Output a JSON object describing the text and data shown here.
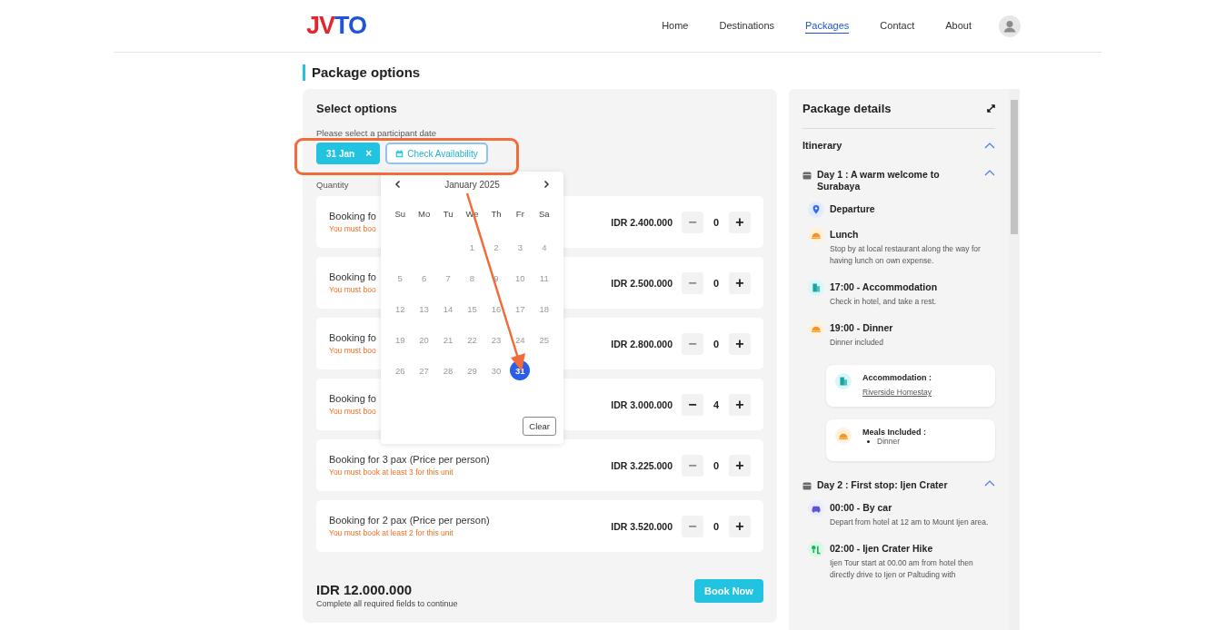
{
  "header": {
    "logo": [
      {
        "text": "JV",
        "color": "#e3262d"
      },
      {
        "text": "TO",
        "color": "#1f55d6"
      }
    ],
    "nav": [
      {
        "label": "Home",
        "selected": false
      },
      {
        "label": "Destinations",
        "selected": false
      },
      {
        "label": "Packages",
        "selected": true
      },
      {
        "label": "Contact",
        "selected": false
      },
      {
        "label": "About",
        "selected": false
      }
    ]
  },
  "page_title": "Package options",
  "options": {
    "title": "Select options",
    "date_label": "Please select a participant date",
    "date_chip": "31 Jan",
    "chip_remove": "×",
    "check_button": "Check Availability",
    "quantity_label": "Quantity",
    "calendar": {
      "open": true,
      "month": "January 2025",
      "weekdays": [
        "Su",
        "Mo",
        "Tu",
        "We",
        "Th",
        "Fr",
        "Sa"
      ],
      "weeks": [
        {
          "kind": "leading",
          "days": [
            {
              "label": "1",
              "disabled": true,
              "selected": false
            },
            {
              "label": "2",
              "disabled": true,
              "selected": false
            },
            {
              "label": "3",
              "disabled": true,
              "selected": false
            },
            {
              "label": "4",
              "disabled": true,
              "selected": false
            }
          ]
        },
        {
          "kind": "full",
          "days": [
            {
              "label": "5",
              "disabled": true,
              "selected": false
            },
            {
              "label": "6",
              "disabled": true,
              "selected": false
            },
            {
              "label": "7",
              "disabled": true,
              "selected": false
            },
            {
              "label": "8",
              "disabled": true,
              "selected": false
            },
            {
              "label": "9",
              "disabled": true,
              "selected": false
            },
            {
              "label": "10",
              "disabled": true,
              "selected": false
            },
            {
              "label": "11",
              "disabled": true,
              "selected": false
            }
          ]
        },
        {
          "kind": "full",
          "days": [
            {
              "label": "12",
              "disabled": true,
              "selected": false
            },
            {
              "label": "13",
              "disabled": true,
              "selected": false
            },
            {
              "label": "14",
              "disabled": true,
              "selected": false
            },
            {
              "label": "15",
              "disabled": true,
              "selected": false
            },
            {
              "label": "16",
              "disabled": true,
              "selected": false
            },
            {
              "label": "17",
              "disabled": true,
              "selected": false
            },
            {
              "label": "18",
              "disabled": true,
              "selected": false
            }
          ]
        },
        {
          "kind": "full",
          "days": [
            {
              "label": "19",
              "disabled": true,
              "selected": false
            },
            {
              "label": "20",
              "disabled": true,
              "selected": false
            },
            {
              "label": "21",
              "disabled": true,
              "selected": false
            },
            {
              "label": "22",
              "disabled": true,
              "selected": false
            },
            {
              "label": "23",
              "disabled": true,
              "selected": false
            },
            {
              "label": "24",
              "disabled": true,
              "selected": false
            },
            {
              "label": "25",
              "disabled": true,
              "selected": false
            }
          ]
        },
        {
          "kind": "trailing",
          "days": [
            {
              "label": "26",
              "disabled": true,
              "selected": false
            },
            {
              "label": "27",
              "disabled": true,
              "selected": false
            },
            {
              "label": "28",
              "disabled": true,
              "selected": false
            },
            {
              "label": "29",
              "disabled": true,
              "selected": false
            },
            {
              "label": "30",
              "disabled": true,
              "selected": false
            },
            {
              "label": "31",
              "disabled": false,
              "selected": true
            }
          ]
        }
      ],
      "clear_button": "Clear"
    },
    "bookings": [
      {
        "title": "Booking fo",
        "note": "You must boo",
        "price": "IDR 2.400.000",
        "quantity": "0",
        "minus": "−",
        "plus": "+",
        "minus_disabled": true
      },
      {
        "title": "Booking fo",
        "note": "You must boo",
        "price": "IDR 2.500.000",
        "quantity": "0",
        "minus": "−",
        "plus": "+",
        "minus_disabled": true
      },
      {
        "title": "Booking fo",
        "note": "You must boo",
        "price": "IDR 2.800.000",
        "quantity": "0",
        "minus": "−",
        "plus": "+",
        "minus_disabled": true
      },
      {
        "title": "Booking fo",
        "note": "You must boo",
        "price": "IDR 3.000.000",
        "quantity": "4",
        "minus": "−",
        "plus": "+",
        "minus_disabled": false
      },
      {
        "title": "Booking for 3 pax (Price per person)",
        "note": "You must book at least 3 for this unit",
        "price": "IDR 3.225.000",
        "quantity": "0",
        "minus": "−",
        "plus": "+",
        "minus_disabled": true
      },
      {
        "title": "Booking for 2 pax (Price per person)",
        "note": "You must book at least 2 for this unit",
        "price": "IDR 3.520.000",
        "quantity": "0",
        "minus": "−",
        "plus": "+",
        "minus_disabled": true
      }
    ],
    "total": "IDR 12.000.000",
    "total_note": "Complete all required fields to continue",
    "book_button": "Book Now"
  },
  "package_details": {
    "title": "Package details",
    "section": {
      "title": "Itinerary",
      "expanded": true,
      "days": [
        {
          "title": "Day 1 : A warm welcome to Surabaya",
          "expanded": true,
          "stops": [
            {
              "kind": "location",
              "title": "Departure"
            },
            {
              "kind": "meal",
              "title": "Lunch",
              "description": "Stop by at local restaurant along the way for having lunch on own expense."
            },
            {
              "kind": "hotel",
              "title": "17:00 - Accommodation",
              "description": "Check in hotel, and take a rest."
            },
            {
              "kind": "meal",
              "title": "19:00 - Dinner",
              "description": "Dinner included"
            }
          ],
          "info_cards": [
            {
              "kind": "hotel",
              "label": "Accommodation :",
              "link": "Riverside Homestay"
            },
            {
              "kind": "meal",
              "label": "Meals Included :",
              "items": [
                "Dinner"
              ]
            }
          ]
        },
        {
          "title": "Day 2 : First stop: Ijen Crater",
          "expanded": true,
          "stops": [
            {
              "kind": "car",
              "title": "00:00 - By car",
              "description": "Depart from hotel at 12 am to Mount Ijen area."
            },
            {
              "kind": "hike",
              "title": "02:00 - Ijen Crater Hike",
              "description": "Ijen Tour start at 00.00 am from hotel then directly drive to Ijen or Paltuding with"
            }
          ]
        }
      ]
    }
  }
}
